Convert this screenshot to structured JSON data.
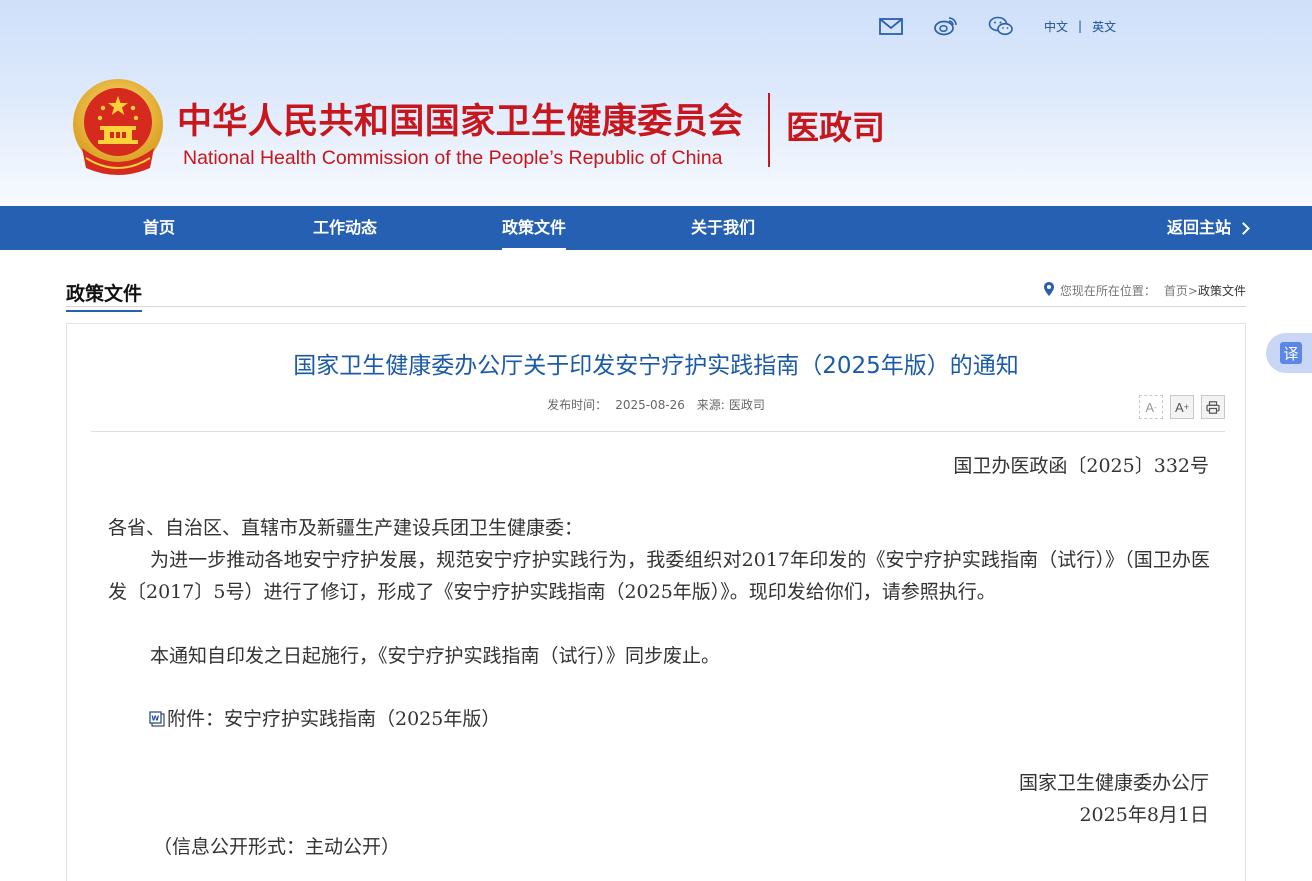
{
  "header": {
    "icons": [
      "mail-icon",
      "weibo-icon",
      "wechat-icon"
    ],
    "lang_cn": "中文",
    "lang_sep": "|",
    "lang_en": "英文",
    "org_cn": "中华人民共和国国家卫生健康委员会",
    "org_en": "National Health Commission of the People’s  Republic of China",
    "dept": "医政司"
  },
  "nav": {
    "items": [
      {
        "label": "首页"
      },
      {
        "label": "工作动态"
      },
      {
        "label": "政策文件",
        "active": true
      },
      {
        "label": "关于我们"
      }
    ],
    "back_label": "返回主站"
  },
  "section": {
    "title": "政策文件",
    "crumb_prefix": "您现在所在位置：",
    "crumb_home": "首页",
    "crumb_sep": ">",
    "crumb_current": "政策文件"
  },
  "article": {
    "title": "国家卫生健康委办公厅关于印发安宁疗护实践指南（2025年版）的通知",
    "date_label": "发布时间：",
    "date": "2025-08-26",
    "source_label": "来源:",
    "source": "医政司",
    "tools": {
      "font_smaller": "A",
      "font_larger": "A",
      "print": "print-icon"
    },
    "doc_no": "国卫办医政函〔2025〕332号",
    "salutation": "各省、自治区、直辖市及新疆生产建设兵团卫生健康委：",
    "para1": "为进一步推动各地安宁疗护发展，规范安宁疗护实践行为，我委组织对2017年印发的《安宁疗护实践指南（试行）》（国卫办医发〔2017〕5号）进行了修订，形成了《安宁疗护实践指南（2025年版）》。现印发给你们，请参照执行。",
    "para2": "本通知自印发之日起施行，《安宁疗护实践指南（试行）》同步废止。",
    "attachment": "附件：安宁疗护实践指南（2025年版）",
    "signer": "国家卫生健康委办公厅",
    "sign_date": "2025年8月1日",
    "disclosure": "（信息公开形式：主动公开）"
  },
  "translate": {
    "label": "译"
  },
  "colors": {
    "nav_bg": "#2660b3",
    "brand_red": "#c8161d",
    "title_blue": "#1b5aa8"
  }
}
